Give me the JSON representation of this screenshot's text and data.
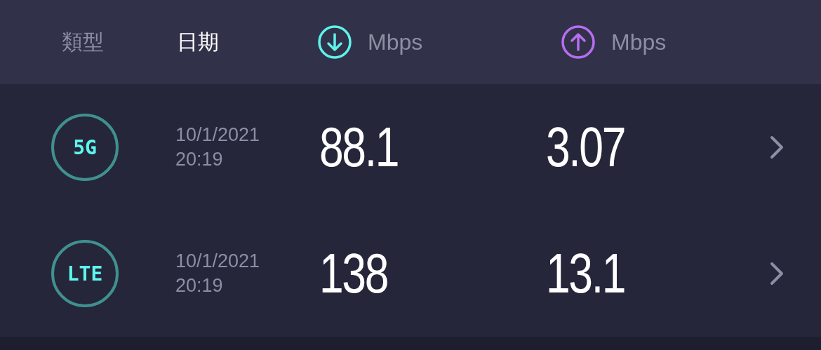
{
  "header": {
    "columns": [
      {
        "kind": "text",
        "label": "類型",
        "selected": false
      },
      {
        "kind": "text",
        "label": "日期",
        "selected": true
      },
      {
        "kind": "download",
        "label": "Mbps",
        "selected": false
      },
      {
        "kind": "upload",
        "label": "Mbps",
        "selected": false
      }
    ]
  },
  "results": [
    {
      "type": "5G",
      "date": "10/1/2021",
      "time": "20:19",
      "download": "88.1",
      "upload": "3.07"
    },
    {
      "type": "LTE",
      "date": "10/1/2021",
      "time": "20:19",
      "download": "138",
      "upload": "13.1"
    }
  ]
}
